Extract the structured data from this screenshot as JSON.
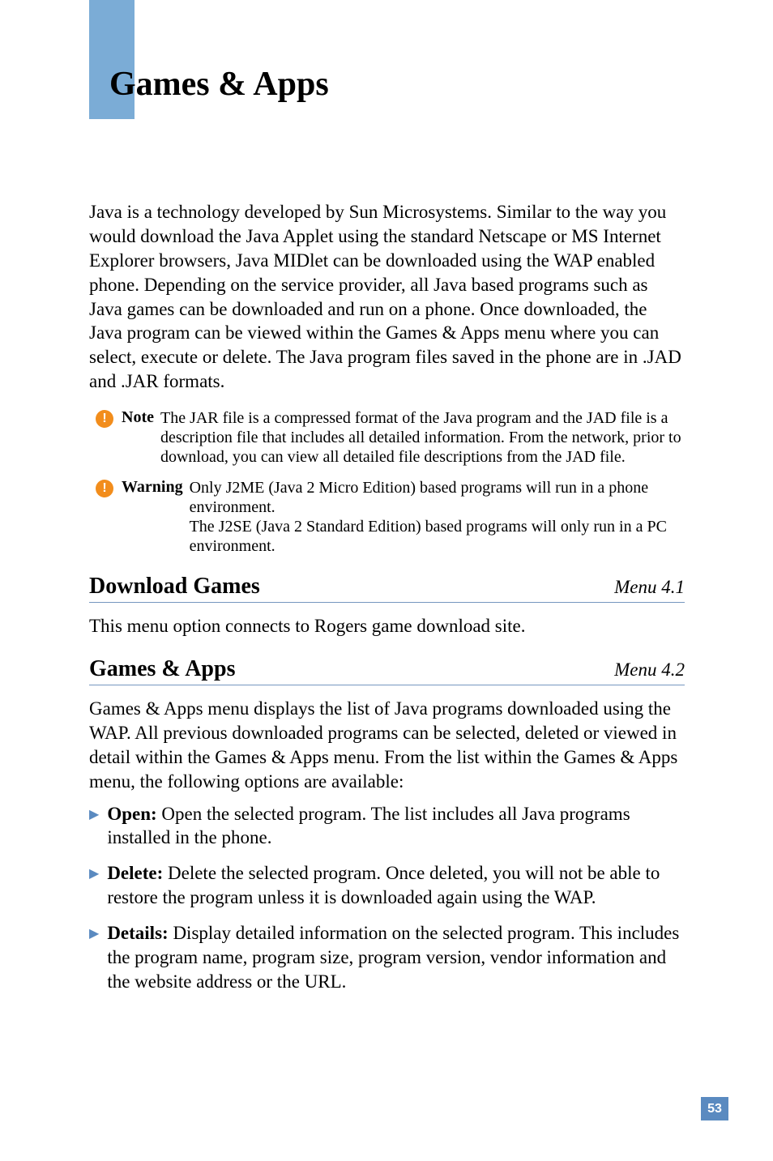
{
  "chapter_title": "Games & Apps",
  "intro": "Java is a technology developed by Sun Microsystems. Similar to the way you would download the Java Applet using the standard Netscape or MS Internet Explorer browsers, Java MIDlet can be downloaded using the WAP enabled phone. Depending on the service provider, all Java based programs such as Java games can be downloaded and run on a phone. Once downloaded, the Java program can be viewed within the Games & Apps menu where you can select, execute or delete. The Java program files saved in the phone are in .JAD and .JAR formats.",
  "note": {
    "label": "Note",
    "text": "The JAR file is a compressed format of the Java program and the JAD file is a description file that includes all detailed information. From the network, prior to download, you can view all detailed file descriptions from the JAD file."
  },
  "warning": {
    "label": "Warning",
    "text": "Only J2ME (Java 2 Micro Edition) based programs will run in a phone environment.\nThe J2SE (Java 2 Standard Edition) based programs will only run in a PC environment."
  },
  "sections": [
    {
      "title": "Download Games",
      "menu": "Menu 4.1",
      "body": "This menu option connects to Rogers game download site."
    },
    {
      "title": "Games & Apps",
      "menu": "Menu 4.2",
      "body": "Games & Apps menu displays the list of Java programs downloaded using the WAP. All previous downloaded programs can be selected, deleted or viewed in detail within the Games & Apps menu. From the list within the Games & Apps menu, the following options are available:"
    }
  ],
  "bullets": [
    {
      "label": "Open:",
      "text": " Open the selected program. The list includes all Java programs installed in the phone."
    },
    {
      "label": "Delete:",
      "text": " Delete the selected program. Once deleted, you will not be able to restore the program unless it is downloaded again using the WAP."
    },
    {
      "label": "Details:",
      "text": " Display detailed information on the selected program. This includes the program name, program size, program version, vendor information and the website address or the URL."
    }
  ],
  "page_number": "53"
}
